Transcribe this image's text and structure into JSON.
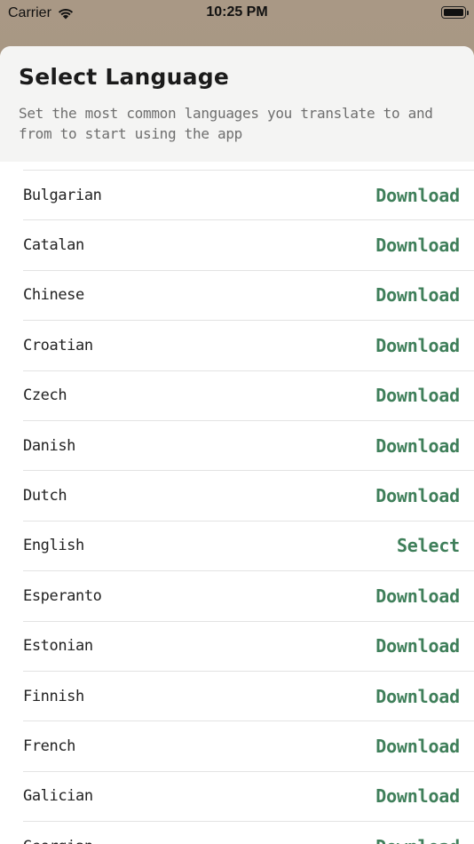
{
  "status_bar": {
    "carrier": "Carrier",
    "time": "10:25 PM"
  },
  "header": {
    "title": "Select Language",
    "subtitle": "Set the most common languages you translate to and from to start using the app"
  },
  "accent_color": "#3f7f5a",
  "languages": [
    {
      "name": "Bulgarian",
      "action": "Download"
    },
    {
      "name": "Catalan",
      "action": "Download"
    },
    {
      "name": "Chinese",
      "action": "Download"
    },
    {
      "name": "Croatian",
      "action": "Download"
    },
    {
      "name": "Czech",
      "action": "Download"
    },
    {
      "name": "Danish",
      "action": "Download"
    },
    {
      "name": "Dutch",
      "action": "Download"
    },
    {
      "name": "English",
      "action": "Select"
    },
    {
      "name": "Esperanto",
      "action": "Download"
    },
    {
      "name": "Estonian",
      "action": "Download"
    },
    {
      "name": "Finnish",
      "action": "Download"
    },
    {
      "name": "French",
      "action": "Download"
    },
    {
      "name": "Galician",
      "action": "Download"
    },
    {
      "name": "Georgian",
      "action": "Download"
    }
  ]
}
